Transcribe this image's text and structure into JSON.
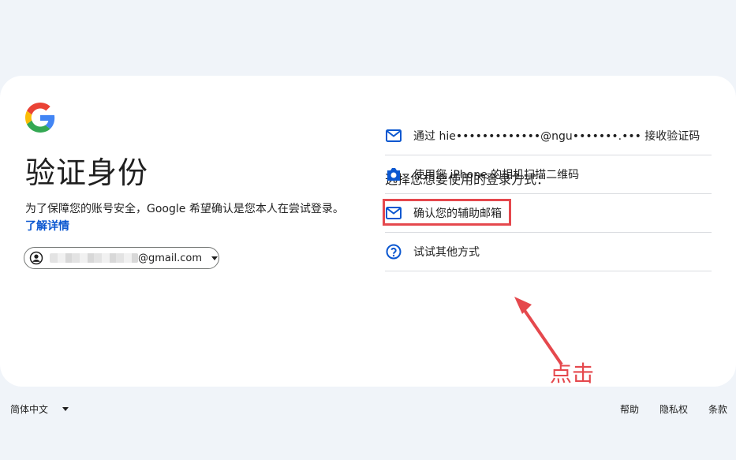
{
  "heading": {
    "title": "验证身份",
    "description": "为了保障您的账号安全，Google 希望确认是您本人在尝试登录。",
    "learn_more": "了解详情"
  },
  "account": {
    "email_suffix": "@gmail.com",
    "avatar_icon": "account-circle-icon"
  },
  "methods": {
    "prompt": "选择您想要使用的登录方式：",
    "items": [
      {
        "label": "通过 hie•••••••••••••@ngu•••••••.••• 接收验证码",
        "icon": "mail-icon"
      },
      {
        "label": "使用您 iPhone 的相机扫描二维码",
        "icon": "camera-icon"
      },
      {
        "label": "确认您的辅助邮箱",
        "icon": "mail-icon"
      },
      {
        "label": "试试其他方式",
        "icon": "help-icon"
      }
    ]
  },
  "annotation": {
    "text": "点击",
    "color": "#e5484d"
  },
  "footer": {
    "language": "简体中文",
    "help": "帮助",
    "privacy": "隐私权",
    "terms": "条款"
  },
  "colors": {
    "link": "#0b57d0",
    "background": "#f0f4f9",
    "highlight": "#e5484d"
  }
}
